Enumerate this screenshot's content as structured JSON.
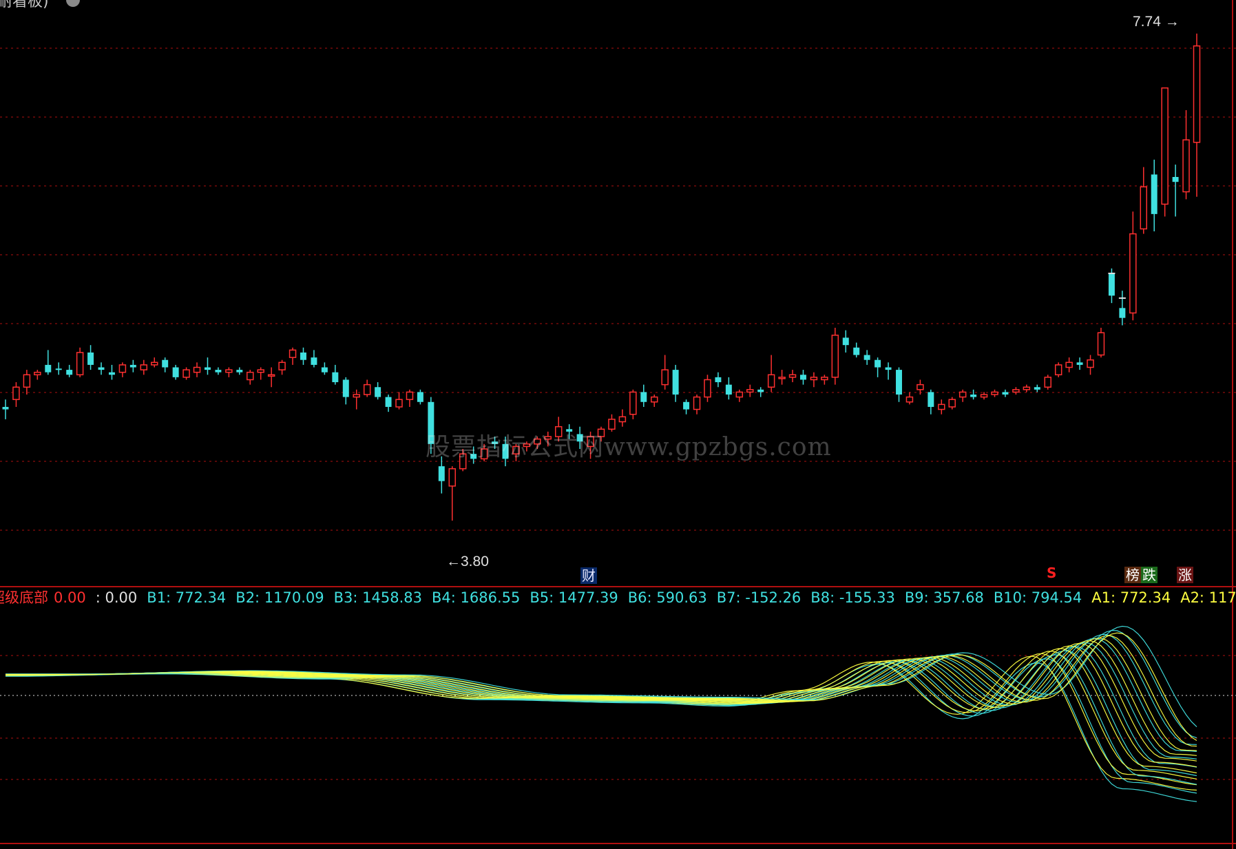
{
  "header": {
    "title": "耐看板)"
  },
  "watermark": "股票指标公式网www.gpzbgs.com",
  "annotations": {
    "high_label": "7.74",
    "low_label": "3.80"
  },
  "badges": {
    "cai": "财",
    "bang": "榜",
    "die": "跌",
    "zhang": "涨",
    "s_mark": "S"
  },
  "indicator": {
    "name": "超级底部",
    "value_main": "0.00",
    "value_secondary": ": 0.00",
    "items": [
      {
        "label": "B1",
        "value": "772.34",
        "color": "#40e0e0"
      },
      {
        "label": "B2",
        "value": "1170.09",
        "color": "#40e0e0"
      },
      {
        "label": "B3",
        "value": "1458.83",
        "color": "#40e0e0"
      },
      {
        "label": "B4",
        "value": "1686.55",
        "color": "#40e0e0"
      },
      {
        "label": "B5",
        "value": "1477.39",
        "color": "#40e0e0"
      },
      {
        "label": "B6",
        "value": "590.63",
        "color": "#40e0e0"
      },
      {
        "label": "B7",
        "value": "-152.26",
        "color": "#40e0e0"
      },
      {
        "label": "B8",
        "value": "-155.33",
        "color": "#40e0e0"
      },
      {
        "label": "B9",
        "value": "357.68",
        "color": "#40e0e0"
      },
      {
        "label": "B10",
        "value": "794.54",
        "color": "#40e0e0"
      },
      {
        "label": "A1",
        "value": "772.34",
        "color": "#ffff40"
      },
      {
        "label": "A2",
        "value": "117",
        "color": "#ffff40"
      }
    ]
  },
  "colors": {
    "up": "#ff3030",
    "down": "#40e0e0",
    "grid": "#b01010",
    "ribbon_cyan": "#40e0e0",
    "ribbon_yellow": "#ffff40"
  },
  "chart_data": [
    {
      "type": "candlestick",
      "title": "",
      "price_range": [
        3.5,
        7.9
      ],
      "high": 7.74,
      "low": 3.8,
      "candles": [
        [
          4.72,
          4.78,
          4.62,
          4.7
        ],
        [
          4.78,
          4.92,
          4.72,
          4.88
        ],
        [
          4.88,
          5.02,
          4.82,
          4.98
        ],
        [
          4.98,
          5.02,
          4.94,
          5.0
        ],
        [
          5.06,
          5.18,
          4.98,
          5.0
        ],
        [
          5.03,
          5.08,
          4.98,
          5.02
        ],
        [
          5.02,
          5.06,
          4.96,
          4.98
        ],
        [
          4.98,
          5.2,
          4.96,
          5.16
        ],
        [
          5.16,
          5.22,
          5.02,
          5.06
        ],
        [
          5.04,
          5.08,
          4.98,
          5.02
        ],
        [
          5.0,
          5.06,
          4.94,
          4.98
        ],
        [
          5.0,
          5.08,
          4.96,
          5.06
        ],
        [
          5.06,
          5.1,
          5.0,
          5.04
        ],
        [
          5.02,
          5.1,
          4.98,
          5.06
        ],
        [
          5.06,
          5.12,
          5.04,
          5.08
        ],
        [
          5.1,
          5.12,
          5.0,
          5.04
        ],
        [
          5.04,
          5.06,
          4.94,
          4.96
        ],
        [
          4.96,
          5.04,
          4.94,
          5.02
        ],
        [
          5.0,
          5.08,
          4.96,
          5.04
        ],
        [
          5.04,
          5.12,
          4.98,
          5.02
        ],
        [
          5.02,
          5.04,
          4.98,
          5.0
        ],
        [
          5.0,
          5.04,
          4.96,
          5.02
        ],
        [
          5.02,
          5.04,
          4.98,
          5.0
        ],
        [
          4.94,
          5.02,
          4.9,
          5.0
        ],
        [
          5.0,
          5.04,
          4.94,
          5.02
        ],
        [
          4.98,
          5.04,
          4.88,
          4.98
        ],
        [
          5.02,
          5.1,
          4.98,
          5.08
        ],
        [
          5.12,
          5.2,
          5.06,
          5.18
        ],
        [
          5.16,
          5.2,
          5.06,
          5.1
        ],
        [
          5.12,
          5.18,
          5.04,
          5.06
        ],
        [
          5.04,
          5.08,
          4.98,
          5.0
        ],
        [
          5.0,
          5.06,
          4.9,
          4.92
        ],
        [
          4.94,
          4.96,
          4.74,
          4.8
        ],
        [
          4.8,
          4.86,
          4.7,
          4.82
        ],
        [
          4.82,
          4.94,
          4.8,
          4.9
        ],
        [
          4.88,
          4.92,
          4.78,
          4.8
        ],
        [
          4.8,
          4.82,
          4.68,
          4.72
        ],
        [
          4.72,
          4.84,
          4.7,
          4.78
        ],
        [
          4.78,
          4.86,
          4.72,
          4.84
        ],
        [
          4.84,
          4.86,
          4.74,
          4.76
        ],
        [
          4.76,
          4.8,
          4.34,
          4.42
        ],
        [
          4.24,
          4.32,
          4.02,
          4.12
        ],
        [
          4.08,
          4.24,
          3.8,
          4.22
        ],
        [
          4.22,
          4.38,
          4.2,
          4.34
        ],
        [
          4.34,
          4.4,
          4.26,
          4.3
        ],
        [
          4.3,
          4.42,
          4.28,
          4.38
        ],
        [
          4.44,
          4.48,
          4.38,
          4.42
        ],
        [
          4.42,
          4.48,
          4.24,
          4.3
        ],
        [
          4.34,
          4.42,
          4.28,
          4.4
        ],
        [
          4.4,
          4.44,
          4.36,
          4.42
        ],
        [
          4.42,
          4.48,
          4.38,
          4.46
        ],
        [
          4.46,
          4.52,
          4.4,
          4.48
        ],
        [
          4.48,
          4.64,
          4.44,
          4.56
        ],
        [
          4.54,
          4.58,
          4.46,
          4.52
        ],
        [
          4.5,
          4.56,
          4.38,
          4.44
        ],
        [
          4.4,
          4.52,
          4.3,
          4.48
        ],
        [
          4.48,
          4.56,
          4.44,
          4.54
        ],
        [
          4.54,
          4.66,
          4.52,
          4.62
        ],
        [
          4.6,
          4.7,
          4.56,
          4.64
        ],
        [
          4.66,
          4.86,
          4.62,
          4.84
        ],
        [
          4.84,
          4.9,
          4.72,
          4.76
        ],
        [
          4.76,
          4.82,
          4.72,
          4.8
        ],
        [
          4.9,
          5.14,
          4.86,
          5.02
        ],
        [
          5.02,
          5.06,
          4.76,
          4.82
        ],
        [
          4.76,
          4.78,
          4.66,
          4.7
        ],
        [
          4.7,
          4.82,
          4.66,
          4.8
        ],
        [
          4.8,
          4.98,
          4.76,
          4.94
        ],
        [
          4.96,
          5.0,
          4.88,
          4.92
        ],
        [
          4.9,
          4.96,
          4.78,
          4.82
        ],
        [
          4.8,
          4.86,
          4.76,
          4.84
        ],
        [
          4.84,
          4.9,
          4.8,
          4.86
        ],
        [
          4.86,
          4.88,
          4.8,
          4.84
        ],
        [
          4.88,
          5.14,
          4.84,
          4.98
        ],
        [
          4.96,
          5.02,
          4.9,
          4.96
        ],
        [
          4.96,
          5.02,
          4.92,
          4.98
        ],
        [
          4.98,
          5.02,
          4.9,
          4.94
        ],
        [
          4.94,
          5.0,
          4.88,
          4.96
        ],
        [
          4.94,
          4.98,
          4.9,
          4.96
        ],
        [
          4.96,
          5.36,
          4.9,
          5.3
        ],
        [
          5.28,
          5.34,
          5.16,
          5.22
        ],
        [
          5.2,
          5.24,
          5.12,
          5.14
        ],
        [
          5.14,
          5.18,
          5.06,
          5.1
        ],
        [
          5.1,
          5.12,
          4.96,
          5.04
        ],
        [
          5.04,
          5.08,
          4.94,
          5.02
        ],
        [
          5.02,
          5.04,
          4.76,
          4.82
        ],
        [
          4.76,
          4.84,
          4.74,
          4.8
        ],
        [
          4.86,
          4.94,
          4.82,
          4.9
        ],
        [
          4.84,
          4.86,
          4.66,
          4.72
        ],
        [
          4.7,
          4.78,
          4.66,
          4.74
        ],
        [
          4.72,
          4.8,
          4.7,
          4.78
        ],
        [
          4.8,
          4.86,
          4.76,
          4.84
        ],
        [
          4.82,
          4.86,
          4.78,
          4.8
        ],
        [
          4.8,
          4.84,
          4.78,
          4.82
        ],
        [
          4.82,
          4.86,
          4.8,
          4.84
        ],
        [
          4.84,
          4.86,
          4.8,
          4.82
        ],
        [
          4.84,
          4.88,
          4.82,
          4.86
        ],
        [
          4.86,
          4.9,
          4.84,
          4.88
        ],
        [
          4.88,
          4.9,
          4.84,
          4.86
        ],
        [
          4.88,
          4.98,
          4.86,
          4.96
        ],
        [
          4.98,
          5.08,
          4.96,
          5.06
        ],
        [
          5.04,
          5.12,
          5.0,
          5.08
        ],
        [
          5.08,
          5.12,
          5.02,
          5.06
        ],
        [
          5.04,
          5.14,
          4.98,
          5.1
        ],
        [
          5.14,
          5.36,
          5.12,
          5.32
        ],
        [
          5.8,
          5.84,
          5.56,
          5.62
        ],
        [
          5.52,
          5.66,
          5.38,
          5.44
        ],
        [
          5.48,
          6.3,
          5.42,
          6.12
        ],
        [
          6.16,
          6.66,
          6.12,
          6.5
        ],
        [
          6.6,
          6.72,
          6.14,
          6.28
        ],
        [
          6.36,
          6.7,
          6.26,
          7.3
        ],
        [
          6.58,
          6.68,
          6.26,
          6.54
        ],
        [
          6.46,
          7.12,
          6.4,
          6.88
        ],
        [
          6.86,
          7.74,
          6.42,
          7.64
        ]
      ],
      "extra_ticks": [
        5.6,
        5.8
      ]
    },
    {
      "type": "line",
      "title": "超级底部",
      "description": "multi-line ribbon oscillator (B1-B10 cyan, A1-A10 yellow)",
      "baseline": 0,
      "y_range": [
        -1000,
        500
      ],
      "x": [
        0,
        15,
        30,
        45,
        60,
        68,
        75,
        82,
        90,
        97,
        105,
        113,
        118
      ],
      "ribbon_center": [
        22,
        25,
        20,
        -2,
        -5,
        -8,
        8,
        40,
        -12,
        55,
        -70,
        -80,
        50
      ],
      "ribbon_spread": [
        6,
        8,
        10,
        12,
        14,
        16,
        20,
        28,
        60,
        90,
        140,
        160,
        90
      ]
    }
  ]
}
